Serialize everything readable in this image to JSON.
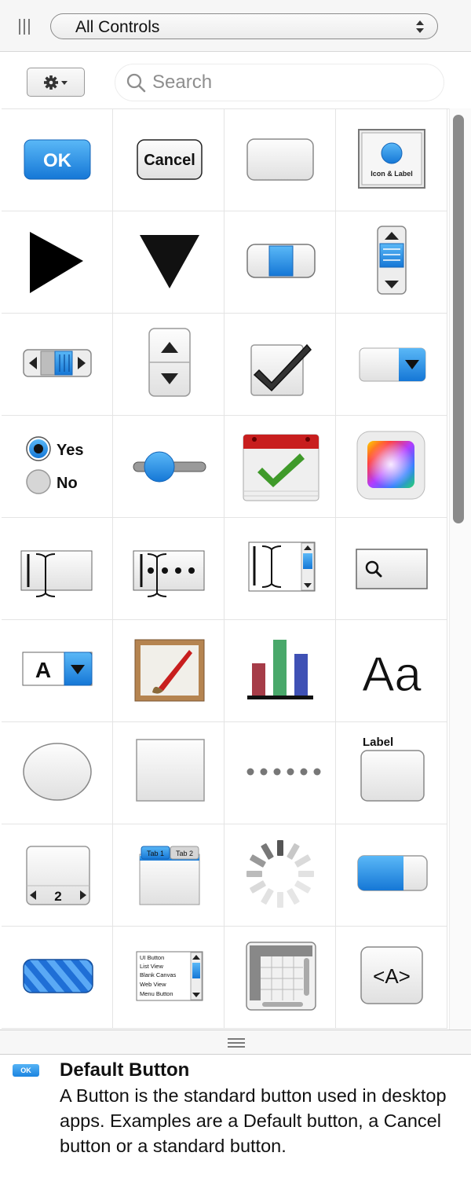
{
  "header": {
    "library_selector": "All Controls",
    "icons": [
      "panel-grip-icon",
      "popup-arrows-icon"
    ]
  },
  "toolbar": {
    "gear_menu_icon": "gear-icon",
    "search_placeholder": "Search"
  },
  "palette": [
    {
      "id": "ok-button",
      "label": "OK"
    },
    {
      "id": "cancel-button",
      "label": "Cancel"
    },
    {
      "id": "plain-button"
    },
    {
      "id": "icon-label-button",
      "label": "Icon & Label"
    },
    {
      "id": "disclosure-triangle-right"
    },
    {
      "id": "disclosure-triangle-down"
    },
    {
      "id": "horizontal-slider-thumb"
    },
    {
      "id": "vertical-scroller"
    },
    {
      "id": "horizontal-scroller"
    },
    {
      "id": "stepper"
    },
    {
      "id": "checkbox"
    },
    {
      "id": "popup-menu-button"
    },
    {
      "id": "radio-group",
      "options": [
        "Yes",
        "No"
      ]
    },
    {
      "id": "slider"
    },
    {
      "id": "date-picker"
    },
    {
      "id": "color-well"
    },
    {
      "id": "text-field"
    },
    {
      "id": "password-field"
    },
    {
      "id": "text-area"
    },
    {
      "id": "search-field"
    },
    {
      "id": "combo-box",
      "label": "A"
    },
    {
      "id": "image-view"
    },
    {
      "id": "bar-chart"
    },
    {
      "id": "label",
      "label": "Aa"
    },
    {
      "id": "oval-shape"
    },
    {
      "id": "rectangle-shape"
    },
    {
      "id": "separator-dots"
    },
    {
      "id": "box-with-label",
      "label": "Label"
    },
    {
      "id": "page-control",
      "label": "2"
    },
    {
      "id": "tab-view",
      "tabs": [
        "Tab 1",
        "Tab 2"
      ]
    },
    {
      "id": "progress-spinner"
    },
    {
      "id": "progress-bar"
    },
    {
      "id": "indeterminate-progress-bar"
    },
    {
      "id": "list-view",
      "items": [
        "UI Button",
        "List View",
        "Blank Canvas",
        "Web View",
        "Menu Button"
      ]
    },
    {
      "id": "table-view"
    },
    {
      "id": "html-element",
      "label": "<A>"
    }
  ],
  "info": {
    "badge": "OK",
    "title": "Default Button",
    "description": "A Button is the standard button used in desktop apps. Examples are a Default button, a Cancel button or a standard button."
  },
  "colors": {
    "accent_blue": "#1b84e0",
    "check_green": "#3f9a2a",
    "date_red": "#c81e1e"
  }
}
